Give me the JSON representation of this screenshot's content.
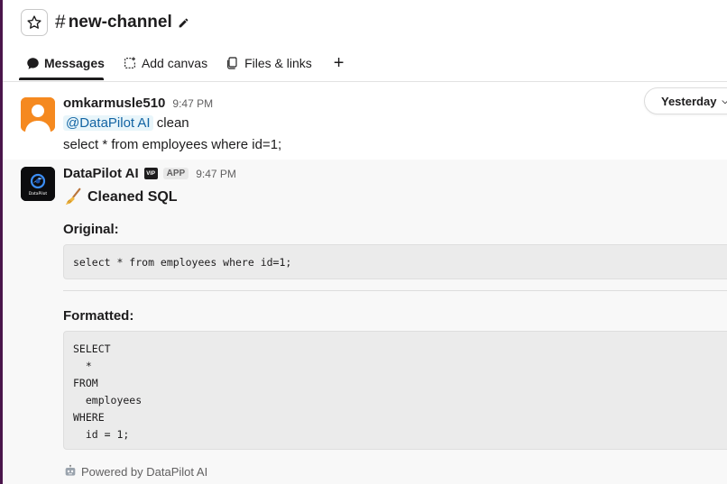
{
  "channel": {
    "title": "new-channel",
    "hash": "#"
  },
  "tabs": [
    {
      "label": "Messages",
      "active": true
    },
    {
      "label": "Add canvas",
      "active": false
    },
    {
      "label": "Files & links",
      "active": false
    }
  ],
  "day_divider": {
    "label": "Yesterday"
  },
  "messages": [
    {
      "sender": "omkarmusle510",
      "time": "9:47 PM",
      "mention": "@DataPilot AI",
      "mention_text": "clean",
      "text": "select * from employees where id=1;"
    },
    {
      "sender": "DataPilot AI",
      "vip_badge": "VIP",
      "app_badge": "APP",
      "time": "9:47 PM",
      "heading": "Cleaned SQL",
      "original_label": "Original:",
      "original_code": "select * from employees where id=1;",
      "formatted_label": "Formatted:",
      "formatted_lines": [
        "SELECT",
        "  *",
        "FROM",
        "  employees",
        "WHERE",
        "  id = 1;"
      ],
      "footer": "Powered by DataPilot AI",
      "avatar_text": "DataPilot"
    }
  ],
  "colors": {
    "sidebar_edge": "#4a154b",
    "mention_bg": "#e8f5fa",
    "mention_fg": "#1264a3",
    "user_avatar": "#f5891f"
  }
}
